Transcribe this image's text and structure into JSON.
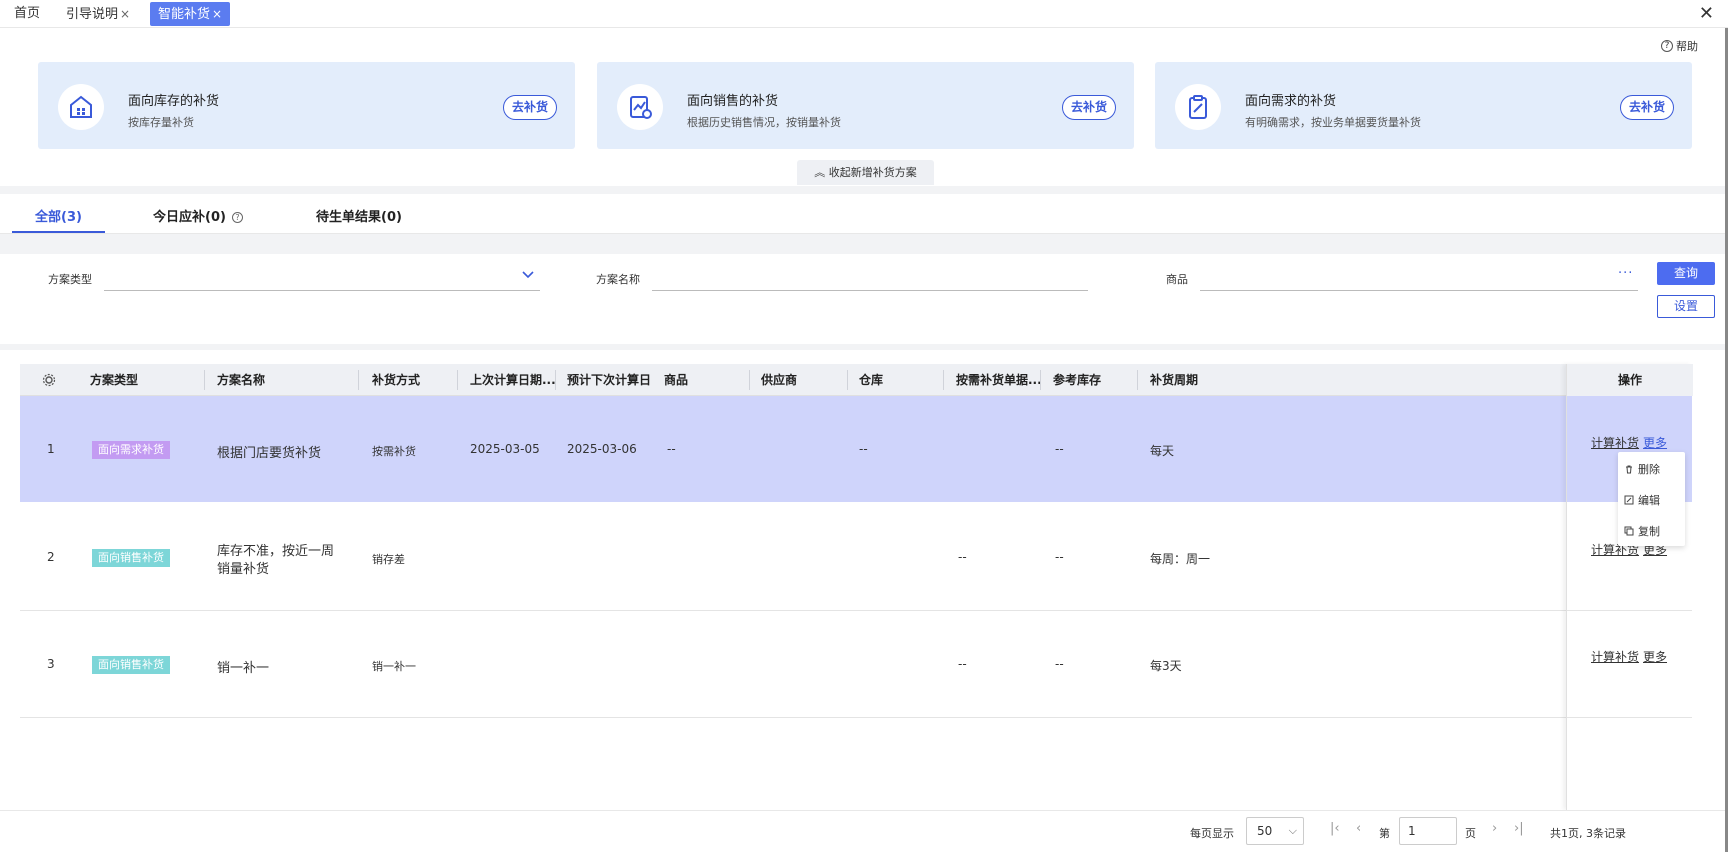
{
  "tabs": [
    {
      "label": "首页",
      "closable": false
    },
    {
      "label": "引导说明",
      "closable": true
    },
    {
      "label": "智能补货",
      "closable": true,
      "active": true
    }
  ],
  "close_symbol": "×",
  "window_close": "✕",
  "help": {
    "icon": "?",
    "label": "帮助"
  },
  "cards": [
    {
      "icon": "warehouse-icon",
      "title": "面向库存的补货",
      "desc": "按库存量补货",
      "button": "去补货"
    },
    {
      "icon": "sales-chart-icon",
      "title": "面向销售的补货",
      "desc": "根据历史销售情况，按销量补货",
      "button": "去补货"
    },
    {
      "icon": "clipboard-icon",
      "title": "面向需求的补货",
      "desc": "有明确需求，按业务单据要货量补货",
      "button": "去补货"
    }
  ],
  "collapse_label": "收起新增补货方案",
  "subtabs": [
    {
      "label": "全部(3)",
      "active": true
    },
    {
      "label": "今日应补(0)",
      "help": "?"
    },
    {
      "label": "待生单结果(0)"
    }
  ],
  "filters": {
    "type_label": "方案类型",
    "name_label": "方案名称",
    "product_label": "商品",
    "more": "···",
    "query_button": "查询",
    "settings_button": "设置"
  },
  "table": {
    "headers": [
      "方案类型",
      "方案名称",
      "补货方式",
      "上次计算日期...",
      "预计下次计算日",
      "商品",
      "供应商",
      "仓库",
      "按需补货单据...",
      "参考库存",
      "补货周期"
    ],
    "op_header": "操作",
    "rows": [
      {
        "idx": "1",
        "type": "面向需求补货",
        "type_kind": "demand",
        "name": "根据门店要货补货",
        "method": "按需补货",
        "last": "2025-03-05",
        "next": "2025-03-06",
        "product": "--",
        "supplier": "",
        "warehouse": "--",
        "doc": "",
        "ref": "--",
        "cycle": "每天"
      },
      {
        "idx": "2",
        "type": "面向销售补货",
        "type_kind": "sales",
        "name_line1": "库存不准，按近一周",
        "name_line2": "销量补货",
        "method": "销存差",
        "last": "",
        "next": "",
        "product": "",
        "supplier": "",
        "warehouse": "",
        "doc": "--",
        "ref": "--",
        "cycle": "每周：周一"
      },
      {
        "idx": "3",
        "type": "面向销售补货",
        "type_kind": "sales",
        "name": "销一补一",
        "method": "销一补一",
        "last": "",
        "next": "",
        "product": "",
        "supplier": "",
        "warehouse": "",
        "doc": "--",
        "ref": "--",
        "cycle": "每3天"
      }
    ],
    "op_calc": "计算补货",
    "op_more": "更多"
  },
  "dropdown": [
    {
      "icon": "trash-icon",
      "label": "删除"
    },
    {
      "icon": "edit-icon",
      "label": "编辑"
    },
    {
      "icon": "copy-icon",
      "label": "复制"
    }
  ],
  "pager": {
    "per_page_label": "每页显示",
    "per_page": "50",
    "page_prefix": "第",
    "page": "1",
    "page_suffix": "页",
    "summary": "共1页, 3条记录"
  },
  "colors": {
    "accent": "#3a5ad9",
    "selected_row": "#cfd4fb",
    "demand_tag": "#c39bf2",
    "sales_tag": "#7dd6d8",
    "card_bg": "#e3edfb"
  }
}
